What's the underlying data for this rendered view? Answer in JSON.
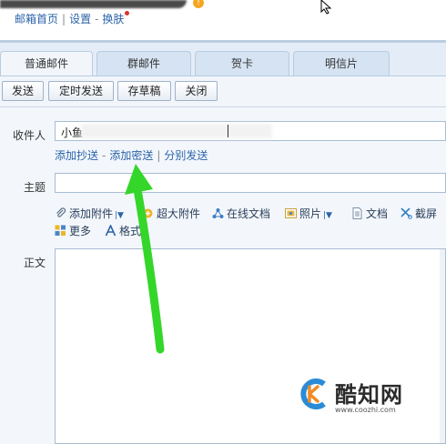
{
  "topnav": {
    "mail_home": "邮箱首页",
    "settings": "设置",
    "skin": "换肤"
  },
  "tabs": [
    {
      "label": "普通邮件",
      "active": true
    },
    {
      "label": "群邮件",
      "active": false
    },
    {
      "label": "贺卡",
      "active": false
    },
    {
      "label": "明信片",
      "active": false
    }
  ],
  "toolbar": {
    "send": "发送",
    "scheduled_send": "定时发送",
    "save_draft": "存草稿",
    "close": "关闭"
  },
  "form": {
    "recipient_label": "收件人",
    "recipient_value": "小鱼",
    "add_cc": "添加抄送",
    "add_bcc": "添加密送",
    "separate_send": "分别发送",
    "subject_label": "主题",
    "subject_value": "",
    "body_label": "正文"
  },
  "attach_tools": {
    "add_attachment": "添加附件",
    "large_attachment": "超大附件",
    "online_doc": "在线文档",
    "photo": "照片",
    "document": "文档",
    "screenshot": "截屏",
    "more": "更多",
    "format": "格式"
  },
  "watermark": {
    "brand": "酷知网",
    "url": "www.coozhi.com"
  },
  "colors": {
    "link": "#2a63a8",
    "tab_bg": "#d5e3f2",
    "arrow": "#35d62a"
  }
}
